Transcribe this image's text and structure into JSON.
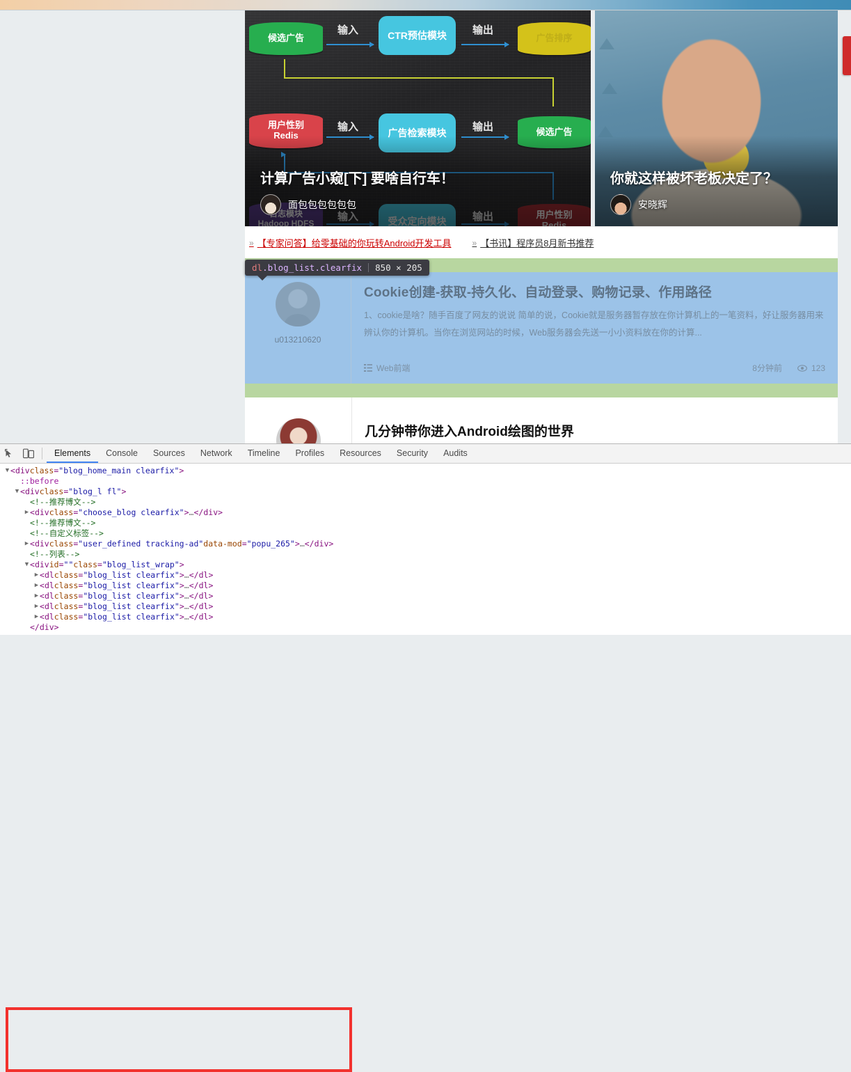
{
  "page": {
    "background_color": "#e9edef",
    "top_strip_colors": [
      "#f3cfa6",
      "#4a93bc"
    ]
  },
  "right_tab": {
    "name": "feedback-tab",
    "color": "#cf2b2b"
  },
  "banners": [
    {
      "title": "计算广告小窥[下] 要啥自行车！",
      "author": "面包包包包包包",
      "diagram": {
        "nodes": [
          {
            "label": "候选广告",
            "color": "#27ae4f",
            "shape": "cylinder"
          },
          {
            "label": "CTR预估模块",
            "color": "#46c6e0",
            "shape": "rounded"
          },
          {
            "label": "广告排序",
            "color": "#d4c21a",
            "shape": "cylinder"
          },
          {
            "label": "用户性别\nRedis",
            "color": "#d9434a",
            "shape": "cylinder"
          },
          {
            "label": "广告检索模块",
            "color": "#46c6e0",
            "shape": "rounded"
          },
          {
            "label": "候选广告",
            "color": "#27ae4f",
            "shape": "cylinder"
          },
          {
            "label": "日志模块\nHadoop HDFS",
            "color": "#5a3d8c",
            "shape": "cylinder"
          },
          {
            "label": "受众定向模块",
            "color": "#46c6e0",
            "shape": "rounded"
          },
          {
            "label": "用户性别\nRedis",
            "color": "#a02c33",
            "shape": "cylinder"
          }
        ],
        "edge_labels": [
          "输入",
          "输出",
          "输入",
          "输出",
          "输入",
          "输出"
        ]
      }
    },
    {
      "title": "你就这样被坏老板决定了？",
      "author": "安晓辉"
    }
  ],
  "link_strip": [
    {
      "chevron": "»",
      "text": "【专家问答】给零基础的你玩转Android开发工具",
      "color": "#cc0000"
    },
    {
      "chevron": "»",
      "text": "【书讯】程序员8月新书推荐",
      "color": "#333333"
    }
  ],
  "inspect_tooltip": {
    "tag": "dl",
    "classes": ".blog_list.clearfix",
    "dimensions": "850 × 205"
  },
  "highlighted_article": {
    "user": "u013210620",
    "title": "Cookie创建-获取-持久化、自动登录、购物记录、作用路径",
    "description": "1、cookie是啥？随手百度了网友的说说 简单的说，Cookie就是服务器暂存放在你计算机上的一笔资料，好让服务器用来辨认你的计算机。当你在浏览网站的时候，Web服务器会先送一小小资料放在你的计算...",
    "category_icon": "list-icon",
    "category": "Web前端",
    "time": "8分钟前",
    "views_icon": "eye-icon",
    "views": "123",
    "overlay": {
      "margin_color": "#b8d6a0",
      "content_color": "#9cc3e8"
    }
  },
  "next_article": {
    "title": "几分钟带你进入Android绘图的世界"
  },
  "devtools": {
    "toolbar_icons": [
      {
        "name": "inspect-element-icon"
      },
      {
        "name": "device-toolbar-icon"
      }
    ],
    "tabs": [
      {
        "label": "Elements",
        "active": true
      },
      {
        "label": "Console",
        "active": false
      },
      {
        "label": "Sources",
        "active": false
      },
      {
        "label": "Network",
        "active": false
      },
      {
        "label": "Timeline",
        "active": false
      },
      {
        "label": "Profiles",
        "active": false
      },
      {
        "label": "Resources",
        "active": false
      },
      {
        "label": "Security",
        "active": false
      },
      {
        "label": "Audits",
        "active": false
      }
    ],
    "tree": [
      {
        "indent": 0,
        "twisty": "▼",
        "type": "open-tag",
        "tag": "div",
        "attrs": [
          {
            "name": "class",
            "value": "blog_home_main clearfix"
          }
        ]
      },
      {
        "indent": 1,
        "twisty": "",
        "type": "pseudo",
        "text": "::before"
      },
      {
        "indent": 1,
        "twisty": "▼",
        "type": "open-tag",
        "tag": "div",
        "attrs": [
          {
            "name": "class",
            "value": "blog_l fl"
          }
        ]
      },
      {
        "indent": 2,
        "twisty": "",
        "type": "comment",
        "text": "<!--推荐博文-->"
      },
      {
        "indent": 2,
        "twisty": "▶",
        "type": "collapsed",
        "tag": "div",
        "attrs": [
          {
            "name": "class",
            "value": "choose_blog clearfix"
          }
        ]
      },
      {
        "indent": 2,
        "twisty": "",
        "type": "comment",
        "text": "<!--推荐博文-->"
      },
      {
        "indent": 2,
        "twisty": "",
        "type": "comment",
        "text": "<!--自定义标签-->"
      },
      {
        "indent": 2,
        "twisty": "▶",
        "type": "collapsed",
        "tag": "div",
        "attrs": [
          {
            "name": "class",
            "value": "user_defined tracking-ad"
          },
          {
            "name": "data-mod",
            "value": "popu_265"
          }
        ]
      },
      {
        "indent": 2,
        "twisty": "",
        "type": "comment",
        "text": "<!--列表-->"
      },
      {
        "indent": 2,
        "twisty": "▼",
        "type": "open-tag",
        "tag": "div",
        "attrs": [
          {
            "name": "id",
            "value": ""
          },
          {
            "name": "class",
            "value": "blog_list_wrap"
          }
        ]
      },
      {
        "indent": 3,
        "twisty": "▶",
        "type": "collapsed",
        "tag": "dl",
        "attrs": [
          {
            "name": "class",
            "value": "blog_list clearfix"
          }
        ]
      },
      {
        "indent": 3,
        "twisty": "▶",
        "type": "collapsed",
        "tag": "dl",
        "attrs": [
          {
            "name": "class",
            "value": "blog_list clearfix"
          }
        ]
      },
      {
        "indent": 3,
        "twisty": "▶",
        "type": "collapsed",
        "tag": "dl",
        "attrs": [
          {
            "name": "class",
            "value": "blog_list clearfix"
          }
        ]
      },
      {
        "indent": 3,
        "twisty": "▶",
        "type": "collapsed",
        "tag": "dl",
        "attrs": [
          {
            "name": "class",
            "value": "blog_list clearfix"
          }
        ]
      },
      {
        "indent": 3,
        "twisty": "▶",
        "type": "collapsed",
        "tag": "dl",
        "attrs": [
          {
            "name": "class",
            "value": "blog_list clearfix"
          }
        ]
      },
      {
        "indent": 2,
        "twisty": "",
        "type": "close-tag",
        "tag": "div"
      }
    ],
    "annotation_rect_color": "#f2322e"
  }
}
